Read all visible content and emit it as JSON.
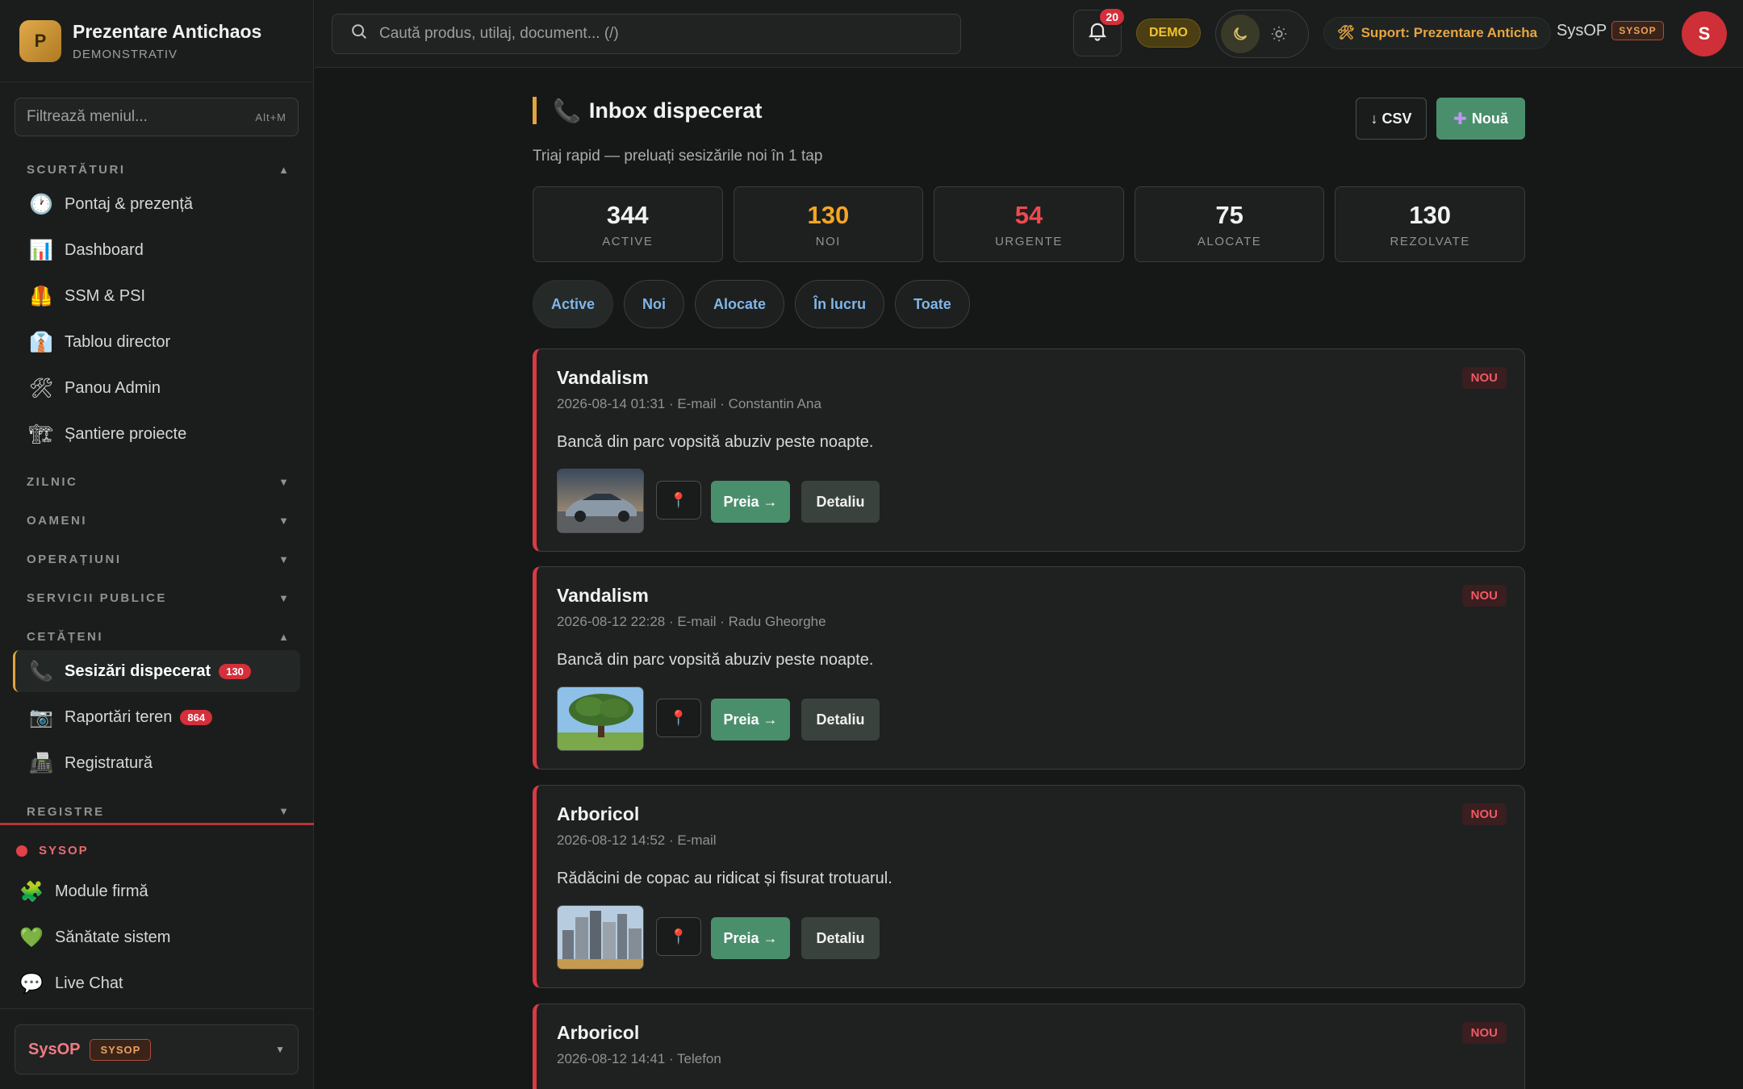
{
  "brand": {
    "logo_letter": "P",
    "name": "Prezentare Antichaos",
    "sub": "DEMONSTRATIV"
  },
  "sidebar": {
    "filter_placeholder": "Filtrează meniul...",
    "filter_kbd": "Alt+M",
    "sections": {
      "shortcuts": "SCURTĂTURI",
      "daily": "ZILNIC",
      "people": "OAMENI",
      "operations": "OPERAȚIUNI",
      "public": "SERVICII PUBLICE",
      "citizens": "CETĂȚENI",
      "registers": "REGISTRE"
    },
    "shortcut_items": [
      {
        "label": "Pontaj & prezență",
        "icon": "clock-icon"
      },
      {
        "label": "Dashboard",
        "icon": "bar-chart-icon"
      },
      {
        "label": "SSM & PSI",
        "icon": "safety-vest-icon"
      },
      {
        "label": "Tablou director",
        "icon": "suit-icon"
      },
      {
        "label": "Panou Admin",
        "icon": "tools-icon"
      },
      {
        "label": "Șantiere proiecte",
        "icon": "crane-icon"
      }
    ],
    "citizen_items": [
      {
        "label": "Sesizări dispecerat",
        "badge": "130",
        "icon": "phone-icon"
      },
      {
        "label": "Raportări teren",
        "badge": "864",
        "icon": "camera-icon"
      },
      {
        "label": "Registratură",
        "icon": "fax-icon"
      }
    ],
    "sysop": {
      "head": "SYSOP",
      "items": [
        {
          "label": "Module firmă",
          "icon": "puzzle-icon"
        },
        {
          "label": "Sănătate sistem",
          "icon": "heart-icon"
        },
        {
          "label": "Live Chat",
          "icon": "chat-bubble-icon"
        }
      ]
    },
    "user": {
      "name": "SysOP",
      "role": "SYSOP"
    }
  },
  "topbar": {
    "search_placeholder": "Caută produs, utilaj, document... (/)",
    "notifications": "20",
    "demo": "DEMO",
    "support": "Suport: Prezentare Anticha",
    "user_name": "SysOP",
    "user_role": "SYSOP",
    "avatar": "S"
  },
  "page": {
    "title": "Inbox dispecerat",
    "subtitle": "Triaj rapid — preluați sesizările noi în 1 tap",
    "csv": "↓ CSV",
    "new": "Nouă",
    "stats": [
      {
        "value": "344",
        "label": "ACTIVE",
        "color": "#f2f2f0"
      },
      {
        "value": "130",
        "label": "NOI",
        "color": "#f5a524"
      },
      {
        "value": "54",
        "label": "URGENTE",
        "color": "#ef4a4f"
      },
      {
        "value": "75",
        "label": "ALOCATE",
        "color": "#f2f2f0"
      },
      {
        "value": "130",
        "label": "REZOLVATE",
        "color": "#f2f2f0"
      }
    ],
    "filters": [
      "Active",
      "Noi",
      "Alocate",
      "În lucru",
      "Toate"
    ],
    "take_label": "Preia →",
    "detail_label": "Detaliu",
    "tickets": [
      {
        "title": "Vandalism",
        "meta": "2026-08-14 01:31 · E-mail · Constantin Ana",
        "desc": "Bancă din parc vopsită abuziv peste noapte.",
        "status": "NOU",
        "thumb": "car"
      },
      {
        "title": "Vandalism",
        "meta": "2026-08-12 22:28 · E-mail · Radu Gheorghe",
        "desc": "Bancă din parc vopsită abuziv peste noapte.",
        "status": "NOU",
        "thumb": "tree"
      },
      {
        "title": "Arboricol",
        "meta": "2026-08-12 14:52 · E-mail",
        "desc": "Rădăcini de copac au ridicat și fisurat trotuarul.",
        "status": "NOU",
        "thumb": "city"
      },
      {
        "title": "Arboricol",
        "meta": "2026-08-12 14:41 · Telefon",
        "desc": "",
        "status": "NOU",
        "thumb": ""
      }
    ]
  }
}
